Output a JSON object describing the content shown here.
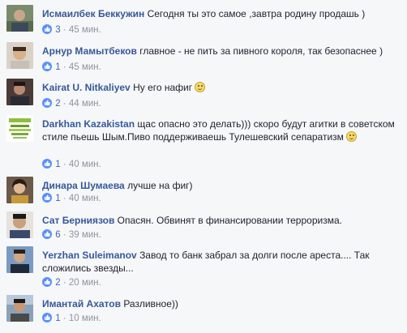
{
  "comments": [
    {
      "author": "Исмаилбек Беккужин",
      "text": "Сегодня ты это самое ,завтра родину продашь )",
      "likes": "3",
      "time": "45 мин."
    },
    {
      "author": "Арнур Мамытбеков",
      "text": "главное - не пить за пивного короля, так безопаснее )",
      "likes": "1",
      "time": "45 мин."
    },
    {
      "author": "Kairat U. Nitkaliyev",
      "text": "Ну его нафиг",
      "likes": "2",
      "time": "44 мин.",
      "emoji": "smile-emoji"
    },
    {
      "author": "Darkhan Kazakistan",
      "text": "щас опасно это делать))) скоро будут агитки в советском стиле пьешь Шым.Пиво поддерживаешь Тулешевский сепаратизм",
      "likes": "1",
      "time": "40 мин.",
      "emoji": "smile-emoji"
    },
    {
      "author": "Динара Шумаева",
      "text": "лучше на фиг)",
      "likes": "1",
      "time": "40 мин."
    },
    {
      "author": "Сат Берниязов",
      "text": "Опасян. Обвинят в финансировании терроризма.",
      "likes": "6",
      "time": "39 мин."
    },
    {
      "author": "Yerzhan Suleimanov",
      "text": "Завод то банк забрал за долги после ареста.... Так сложились звезды...",
      "likes": "2",
      "time": "20 мин."
    },
    {
      "author": "Имантай Ахатов",
      "text": "Разливное))",
      "likes": "1",
      "time": "10 мин."
    }
  ],
  "separator": "·",
  "colors": {
    "author": "#365899",
    "text": "#1d2129",
    "meta": "#90949c",
    "like": "#4267b2",
    "background": "#f6f7f9"
  }
}
